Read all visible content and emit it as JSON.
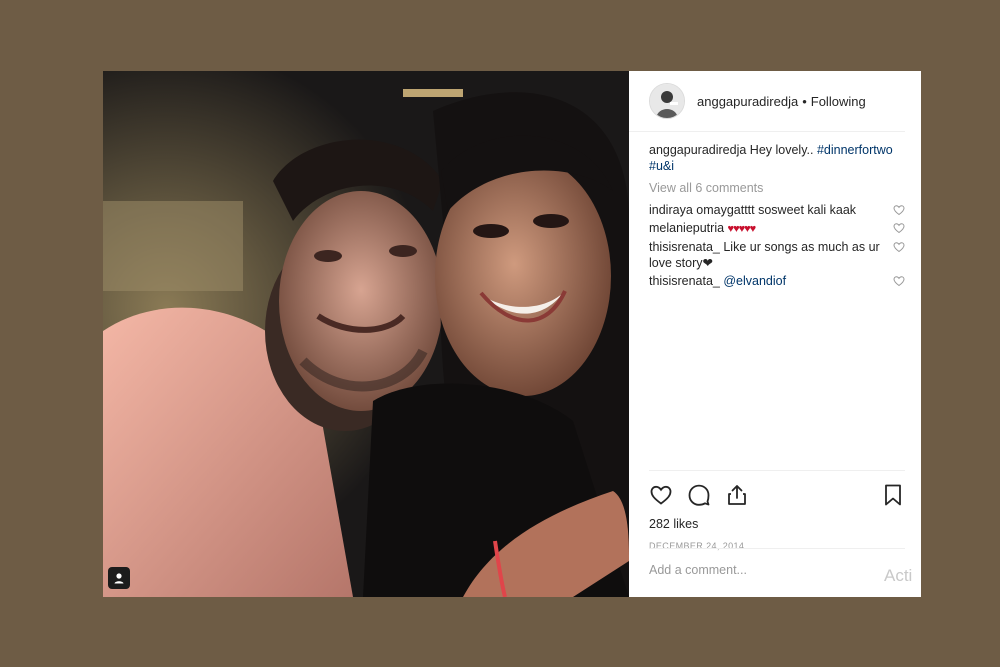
{
  "post": {
    "author": "anggapuradiredja",
    "separator": "•",
    "follow_status": "Following",
    "caption": {
      "user": "anggapuradiredja",
      "text": "Hey lovely..",
      "hashtag1": "#dinnerfortwo",
      "hashtag2": "#u&i"
    },
    "view_all": "View all 6 comments",
    "comments": [
      {
        "user": "indiraya",
        "text": "omaygatttt sosweet kali kaak"
      },
      {
        "user": "melanieputria",
        "text": "♥♥♥♥♥"
      },
      {
        "user": "thisisrenata_",
        "text": "Like ur songs as much as ur love story❤"
      },
      {
        "user": "thisisrenata_",
        "mention": "@elvandiof"
      }
    ],
    "likes": "282 likes",
    "date": "DECEMBER 24, 2014",
    "add_comment_placeholder": "Add a comment..."
  },
  "watermark": "Acti",
  "icons": {
    "like": "heart-icon",
    "comment": "comment-icon",
    "share": "share-icon",
    "save": "bookmark-icon",
    "tag": "user-tag-icon"
  },
  "colors": {
    "background": "#6e5c45",
    "hashtag": "#003569",
    "muted": "#999999",
    "text": "#262626"
  }
}
